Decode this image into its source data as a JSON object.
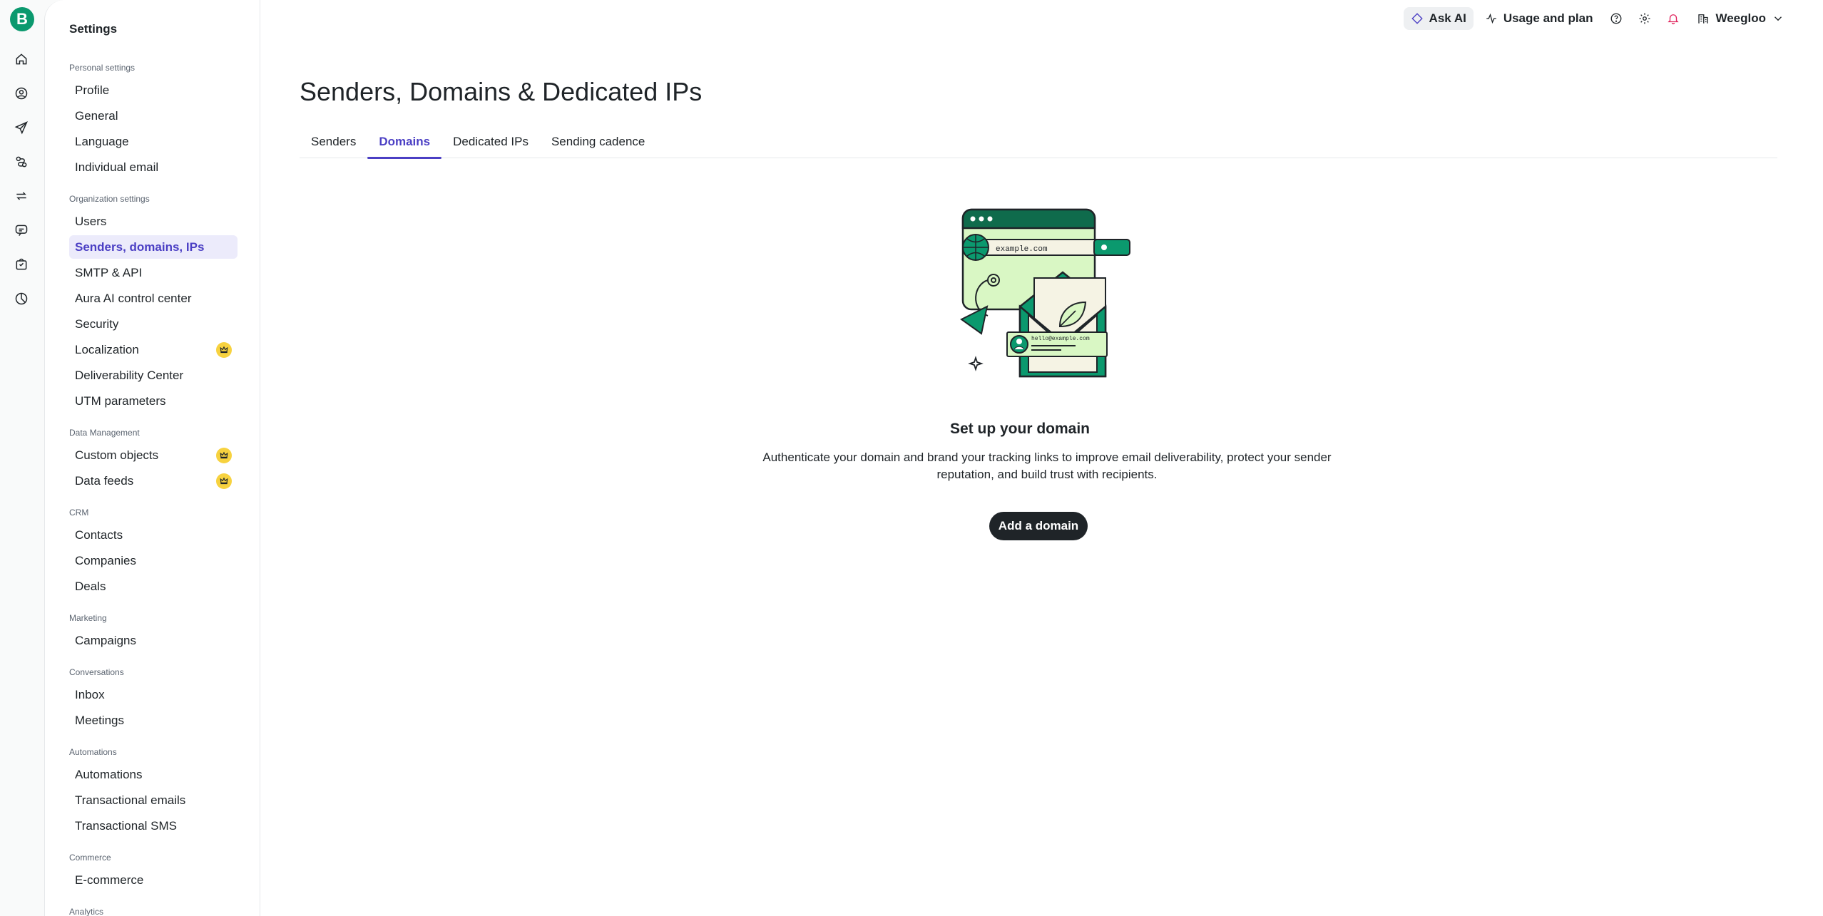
{
  "rail": {
    "logo_letter": "B",
    "items": [
      {
        "name": "home-icon"
      },
      {
        "name": "contacts-icon"
      },
      {
        "name": "campaigns-icon"
      },
      {
        "name": "automations-icon"
      },
      {
        "name": "sync-icon"
      },
      {
        "name": "conversations-icon"
      },
      {
        "name": "commerce-icon"
      },
      {
        "name": "analytics-icon"
      }
    ]
  },
  "topbar": {
    "ask_ai": "Ask AI",
    "usage": "Usage and plan",
    "org": "Weegloo"
  },
  "sidebar": {
    "title": "Settings",
    "sections": [
      {
        "label": "Personal settings",
        "items": [
          {
            "label": "Profile"
          },
          {
            "label": "General"
          },
          {
            "label": "Language"
          },
          {
            "label": "Individual email"
          }
        ]
      },
      {
        "label": "Organization settings",
        "items": [
          {
            "label": "Users"
          },
          {
            "label": "Senders, domains, IPs",
            "active": true
          },
          {
            "label": "SMTP & API"
          },
          {
            "label": "Aura AI control center"
          },
          {
            "label": "Security"
          },
          {
            "label": "Localization",
            "premium": true
          },
          {
            "label": "Deliverability Center"
          },
          {
            "label": "UTM parameters"
          }
        ]
      },
      {
        "label": "Data Management",
        "items": [
          {
            "label": "Custom objects",
            "premium": true
          },
          {
            "label": "Data feeds",
            "premium": true
          }
        ]
      },
      {
        "label": "CRM",
        "items": [
          {
            "label": "Contacts"
          },
          {
            "label": "Companies"
          },
          {
            "label": "Deals"
          }
        ]
      },
      {
        "label": "Marketing",
        "items": [
          {
            "label": "Campaigns"
          }
        ]
      },
      {
        "label": "Conversations",
        "items": [
          {
            "label": "Inbox"
          },
          {
            "label": "Meetings"
          }
        ]
      },
      {
        "label": "Automations",
        "items": [
          {
            "label": "Automations"
          },
          {
            "label": "Transactional emails"
          },
          {
            "label": "Transactional SMS"
          }
        ]
      },
      {
        "label": "Commerce",
        "items": [
          {
            "label": "E-commerce"
          }
        ]
      },
      {
        "label": "Analytics",
        "items": []
      }
    ]
  },
  "page": {
    "title": "Senders, Domains & Dedicated IPs",
    "tabs": [
      {
        "label": "Senders"
      },
      {
        "label": "Domains",
        "active": true
      },
      {
        "label": "Dedicated IPs"
      },
      {
        "label": "Sending cadence"
      }
    ]
  },
  "empty_state": {
    "illustration_url_text": "example.com",
    "illustration_email_text": "hello@example.com",
    "title": "Set up your domain",
    "description": "Authenticate your domain and brand your tracking links to improve email deliverability, protect your sender reputation, and build trust with recipients.",
    "button": "Add a domain"
  },
  "colors": {
    "brand_green": "#0b996e",
    "accent_purple": "#4b3fc4",
    "active_bg": "#ecebfb",
    "premium_yellow": "#f7d23f"
  }
}
